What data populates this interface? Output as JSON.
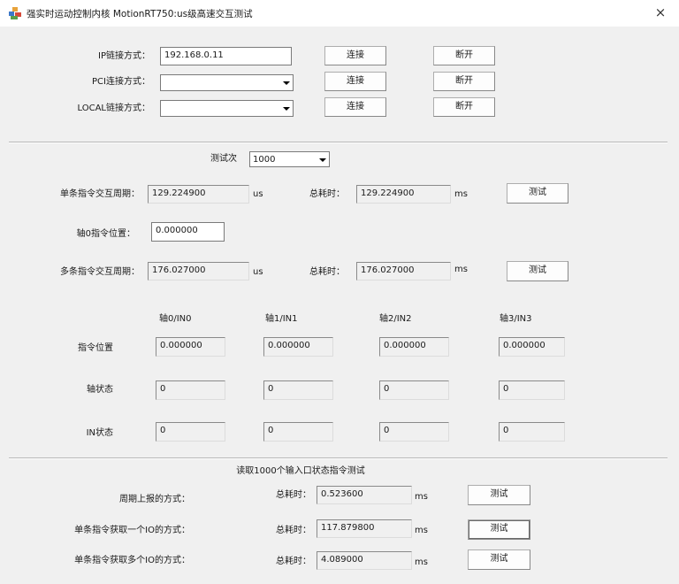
{
  "window": {
    "title": "强实时运动控制内核 MotionRT750:us级高速交互测试",
    "close_glyph": "×",
    "icon": "app-blocks-icon"
  },
  "connection": {
    "ip_label": "IP链接方式：",
    "ip_value": "192.168.0.11",
    "pci_label": "PCI连接方式：",
    "pci_value": "",
    "local_label": "LOCAL链接方式：",
    "local_value": "",
    "connect_label": "连接",
    "disconnect_label": "断开"
  },
  "test": {
    "count_label": "测试次",
    "count_value": "1000",
    "single_label": "单条指令交互周期：",
    "single_value": "129.224900",
    "unit_us": "us",
    "total_label": "总耗时：",
    "single_total": "129.224900",
    "unit_ms": "ms",
    "test_label": "测试",
    "axis0_label": "轴0指令位置：",
    "axis0_value": "0.000000",
    "multi_label": "多条指令交互周期：",
    "multi_value": "176.027000",
    "multi_total": "176.027000"
  },
  "grid": {
    "headers": [
      "轴0/IN0",
      "轴1/IN1",
      "轴2/IN2",
      "轴3/IN3"
    ],
    "rows": [
      {
        "label": "指令位置",
        "values": [
          "0.000000",
          "0.000000",
          "0.000000",
          "0.000000"
        ]
      },
      {
        "label": "轴状态",
        "values": [
          "0",
          "0",
          "0",
          "0"
        ]
      },
      {
        "label": "IN状态",
        "values": [
          "0",
          "0",
          "0",
          "0"
        ]
      }
    ]
  },
  "io": {
    "title": "读取1000个输入口状态指令测试",
    "total_label": "总耗时：",
    "unit_ms": "ms",
    "test_label": "测试",
    "rows": [
      {
        "label": "周期上报的方式：",
        "value": "0.523600"
      },
      {
        "label": "单条指令获取一个IO的方式：",
        "value": "117.879800"
      },
      {
        "label": "单条指令获取多个IO的方式：",
        "value": "4.089000"
      }
    ]
  }
}
